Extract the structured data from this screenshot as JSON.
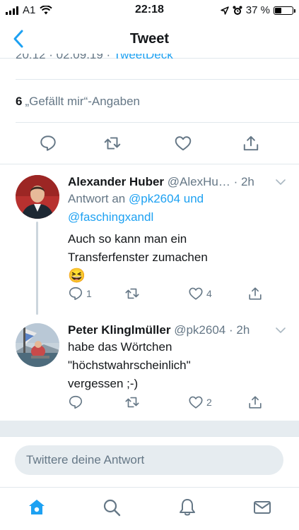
{
  "status": {
    "carrier": "A1",
    "time": "22:18",
    "battery": "37 %",
    "battery_level": 0.37
  },
  "nav": {
    "title": "Tweet"
  },
  "tweet_meta": {
    "datetime": "20:12 · 02.09.19 · ",
    "client": "TweetDeck"
  },
  "likes": {
    "count": "6",
    "label": "„Gefällt mir“-Angaben"
  },
  "replies": [
    {
      "name": "Alexander Huber",
      "handle": "@AlexHu…",
      "time": "· 2h",
      "reply_to_prefix": "Antwort an",
      "reply_to_user1": "@pk2604",
      "reply_to_and": "und",
      "reply_to_user2": "@faschingxandl",
      "text_line1": "Auch so kann man ein",
      "text_line2": "Transferfenster zumachen",
      "emoji": "😆",
      "reply_count": "1",
      "like_count": "4"
    },
    {
      "name": "Peter Klinglmüller",
      "handle": "@pk2604",
      "time": "· 2h",
      "text_line1": "habe das Wörtchen",
      "text_line2": "\"höchstwahrscheinlich\"",
      "text_line3": "vergessen ;-)",
      "reply_count": "",
      "like_count": "2"
    }
  ],
  "reply_box": {
    "placeholder": "Twittere deine Antwort"
  },
  "colors": {
    "accent": "#1da1f2",
    "muted": "#657786",
    "divider": "#e1e8ed"
  }
}
